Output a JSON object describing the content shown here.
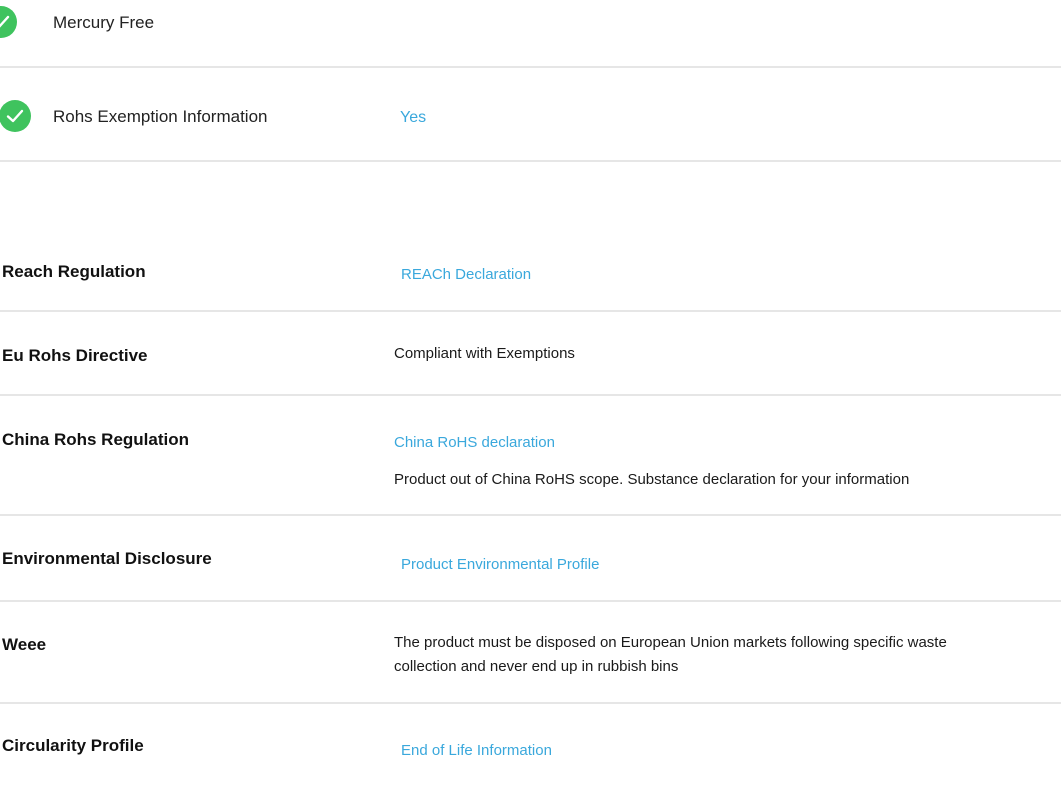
{
  "environmental_checks": [
    {
      "label": "Mercury Free",
      "value": ""
    },
    {
      "label": "Rohs Exemption Information",
      "value": "Yes"
    }
  ],
  "regulations": {
    "reach": {
      "title": "Reach Regulation",
      "link": "REACh Declaration"
    },
    "eu_rohs": {
      "title": "Eu Rohs Directive",
      "text": "Compliant with Exemptions"
    },
    "china_rohs": {
      "title": "China Rohs Regulation",
      "link": "China RoHS declaration",
      "text": "Product out of China RoHS scope. Substance declaration for your information"
    },
    "environmental": {
      "title": "Environmental Disclosure",
      "link": "Product Environmental Profile"
    },
    "weee": {
      "title": "Weee",
      "text_line1": "The product must be disposed on European Union markets following specific waste",
      "text_line2": "collection and never end up in rubbish bins"
    },
    "circularity": {
      "title": "Circularity Profile",
      "link": "End of Life Information"
    }
  },
  "colors": {
    "check_green": "#3fc35e",
    "link_blue": "#3aa8dc",
    "divider": "#e6e6e6"
  },
  "icons": {
    "check": "check-circle-icon"
  }
}
